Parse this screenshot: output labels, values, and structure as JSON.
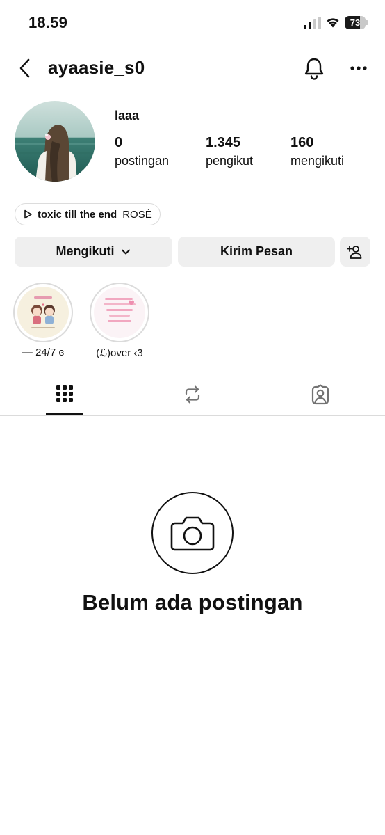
{
  "status_bar": {
    "time": "18.59",
    "battery_level": "73",
    "battery_fraction": 0.73
  },
  "header": {
    "username": "ayaasie_s0",
    "back_icon": "chevron-left-icon",
    "notification_icon": "bell-icon",
    "more_icon": "more-horizontal-icon"
  },
  "profile": {
    "display_name": "laaa",
    "stats": [
      {
        "value": "0",
        "label": "postingan"
      },
      {
        "value": "1.345",
        "label": "pengikut"
      },
      {
        "value": "160",
        "label": "mengikuti"
      }
    ]
  },
  "music": {
    "title": "toxic till the end",
    "artist": "ROSÉ",
    "icon": "play-icon"
  },
  "actions": {
    "follow_label": "Mengikuti",
    "message_label": "Kirim Pesan",
    "add_user_icon": "add-user-icon"
  },
  "highlights": [
    {
      "label": "— 24/7 ɞ"
    },
    {
      "label": "(ℒ)over ‹3"
    }
  ],
  "tabs": [
    {
      "name": "grid",
      "icon": "grid-icon",
      "active": true
    },
    {
      "name": "reposts",
      "icon": "repost-icon",
      "active": false
    },
    {
      "name": "tagged",
      "icon": "tagged-user-icon",
      "active": false
    }
  ],
  "empty_state": {
    "icon": "camera-icon",
    "text": "Belum ada postingan"
  },
  "colors": {
    "text": "#111111",
    "button_bg": "#efefef",
    "divider": "#dbdbdb",
    "tab_inactive": "#737373"
  }
}
